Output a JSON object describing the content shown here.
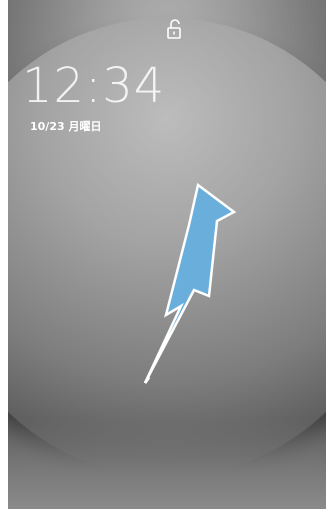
{
  "lockscreen": {
    "time": "12:34",
    "date": "10/23 月曜日",
    "status_icon": "unlock-icon",
    "gesture_icon": "swipe-up-arrow-icon"
  },
  "colors": {
    "arrow_fill": "#6aaedc",
    "arrow_stroke": "#ffffff",
    "text": "#ffffff"
  }
}
